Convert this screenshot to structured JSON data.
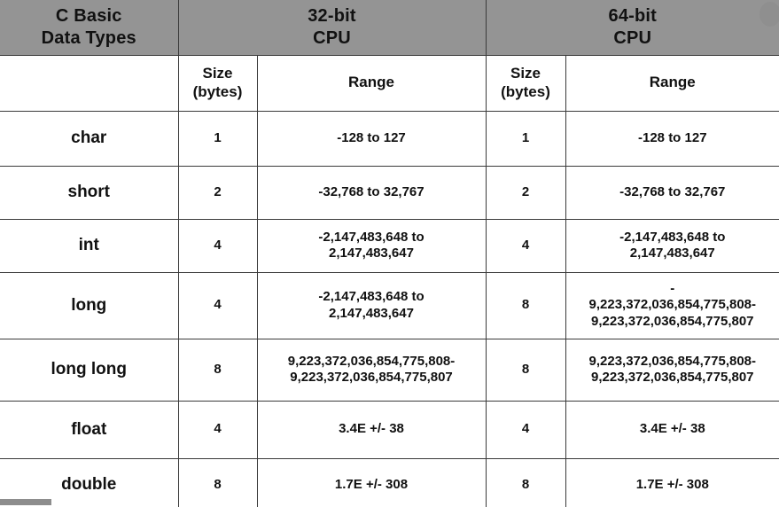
{
  "table": {
    "header_groups": [
      {
        "line1": "C Basic",
        "line2": "Data Types"
      },
      {
        "line1": "32-bit",
        "line2": "CPU"
      },
      {
        "line1": "64-bit",
        "line2": "CPU"
      }
    ],
    "subheaders": {
      "blank": "",
      "size_line1": "Size",
      "size_line2": "(bytes)",
      "range": "Range"
    },
    "columns": [
      "C Basic Data Types",
      "32-bit CPU Size (bytes)",
      "32-bit CPU Range",
      "64-bit CPU Size (bytes)",
      "64-bit CPU Range"
    ],
    "rows": [
      {
        "type": "char",
        "size32": "1",
        "range32": [
          "-128 to 127"
        ],
        "size64": "1",
        "range64": [
          "-128 to 127"
        ]
      },
      {
        "type": "short",
        "size32": "2",
        "range32": [
          "-32,768 to 32,767"
        ],
        "size64": "2",
        "range64": [
          "-32,768 to 32,767"
        ]
      },
      {
        "type": "int",
        "size32": "4",
        "range32": [
          "-2,147,483,648 to",
          "2,147,483,647"
        ],
        "size64": "4",
        "range64": [
          "-2,147,483,648 to",
          "2,147,483,647"
        ]
      },
      {
        "type": "long",
        "size32": "4",
        "range32": [
          "-2,147,483,648 to",
          "2,147,483,647"
        ],
        "size64": "8",
        "range64": [
          "-",
          "9,223,372,036,854,775,808-",
          "9,223,372,036,854,775,807"
        ]
      },
      {
        "type": "long long",
        "size32": "8",
        "range32": [
          "9,223,372,036,854,775,808-",
          "9,223,372,036,854,775,807"
        ],
        "size64": "8",
        "range64": [
          "9,223,372,036,854,775,808-",
          "9,223,372,036,854,775,807"
        ]
      },
      {
        "type": "float",
        "size32": "4",
        "range32": [
          "3.4E +/- 38"
        ],
        "size64": "4",
        "range64": [
          "3.4E +/- 38"
        ]
      },
      {
        "type": "double",
        "size32": "8",
        "range32": [
          "1.7E +/- 308"
        ],
        "size64": "8",
        "range64": [
          "1.7E +/- 308"
        ]
      }
    ]
  },
  "colors": {
    "header_band": "#949494",
    "grid_line": "#3a3a3a",
    "text": "#111111",
    "page_background": "#ffffff",
    "watermark": "#8a8a8a"
  }
}
